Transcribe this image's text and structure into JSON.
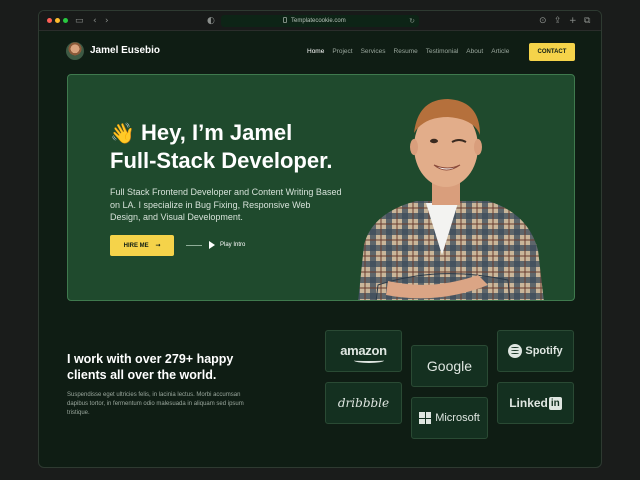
{
  "browser": {
    "url": "Templatecookie.com",
    "icons": [
      "sidebar-icon",
      "back-icon",
      "forward-icon",
      "shield-icon",
      "reload-icon",
      "download-icon",
      "share-icon",
      "new-tab-icon",
      "tabs-icon"
    ]
  },
  "nav": {
    "brand": "Jamel Eusebio",
    "links": [
      "Home",
      "Project",
      "Services",
      "Resume",
      "Testimonial",
      "About",
      "Article"
    ],
    "active": "Home",
    "contact_label": "CONTACT"
  },
  "hero": {
    "wave": "👋",
    "title_line1": "Hey, I’m Jamel",
    "title_line2": "Full-Stack Developer.",
    "description": "Full Stack Frontend Developer and Content Writing Based on LA. I specialize in Bug Fixing, Responsive Web Design, and Visual Development.",
    "hire_label": "HIRE ME",
    "hire_arrow": "→",
    "play_label": "Play Intro"
  },
  "clients": {
    "title": "I work with over 279+ happy clients all over the world.",
    "description": "Suspendisse eget ultricies felis, in lacinia lectus. Morbi accumsan dapibus tortor, in fermentum odio malesuada in aliquam sed ipsum tristique.",
    "logos": [
      "amazon",
      "Google",
      "Spotify",
      "dribbble",
      "Microsoft",
      "Linked",
      "in"
    ]
  },
  "colors": {
    "accent": "#f5d34a",
    "hero_bg": "#1f4a2d",
    "page_bg": "#0f1d14"
  }
}
